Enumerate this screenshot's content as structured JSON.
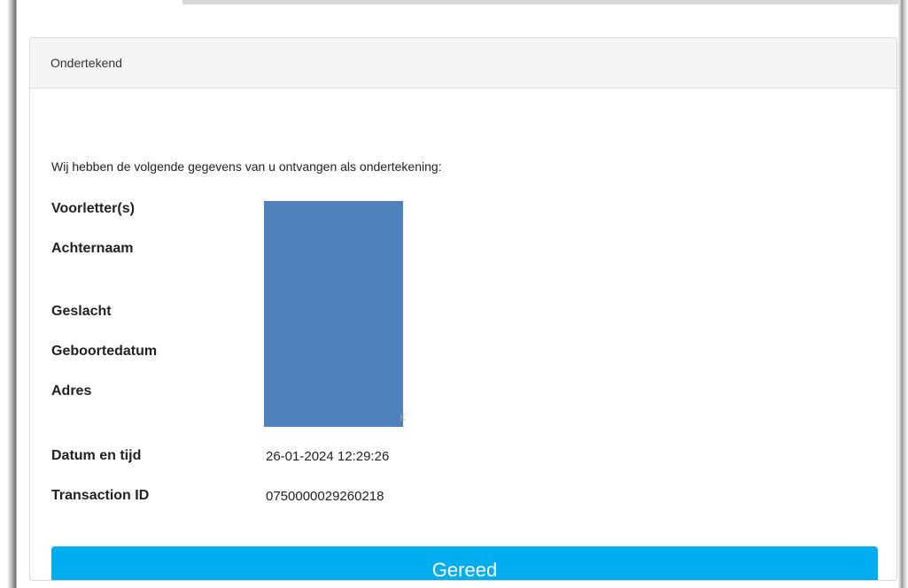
{
  "panel": {
    "title": "Ondertekend",
    "intro": "Wij hebben de volgende gegevens van u ontvangen als ondertekening:"
  },
  "fields": {
    "initials": {
      "label": "Voorletter(s)",
      "value": ""
    },
    "surname": {
      "label": "Achternaam",
      "value": ""
    },
    "gender": {
      "label": "Geslacht",
      "value": ""
    },
    "birthdate": {
      "label": "Geboortedatum",
      "value": ""
    },
    "address": {
      "label": "Adres",
      "value": ""
    },
    "datetime": {
      "label": "Datum en tijd",
      "value": "26-01-2024 12:29:26"
    },
    "transaction": {
      "label": "Transaction ID",
      "value": "0750000029260218"
    }
  },
  "actions": {
    "done_label": "Gereed"
  },
  "colors": {
    "button": "#00aeef",
    "redaction": "#4f81bd",
    "heading_bg": "#f5f5f5"
  }
}
